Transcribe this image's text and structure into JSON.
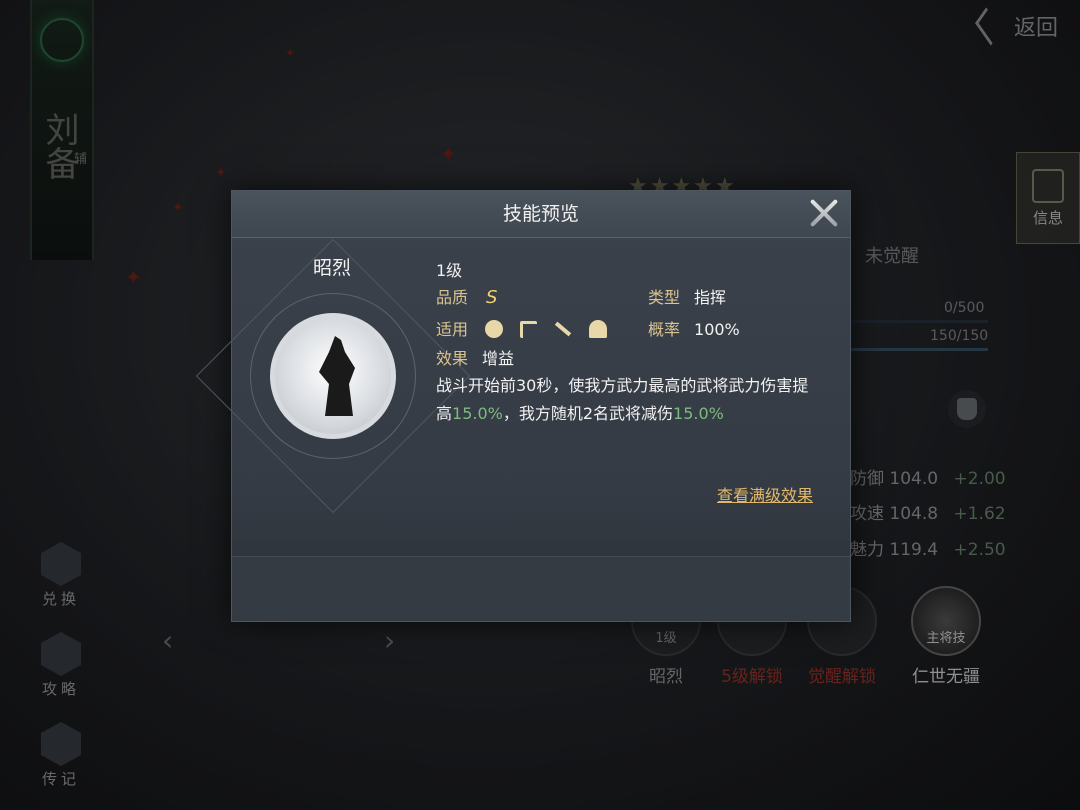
{
  "top": {
    "back_label": "返回"
  },
  "banner": {
    "calligraphy": "刘备",
    "sub": "辅"
  },
  "side_tab": {
    "label": "信息"
  },
  "left_menu": [
    {
      "label": "兑换",
      "icon": "exchange-icon"
    },
    {
      "label": "攻略",
      "icon": "guide-icon"
    },
    {
      "label": "传记",
      "icon": "biography-icon"
    }
  ],
  "right_panel": {
    "stars": "★★★★★",
    "awaken_status": "未觉醒",
    "bar1": "0/500",
    "bar2": "150/150",
    "stats": [
      {
        "name": "防御",
        "value": "104.0",
        "plus": "+2.00"
      },
      {
        "name": "攻速",
        "value": "104.8",
        "plus": "+1.62"
      },
      {
        "name": "魅力",
        "value": "119.4",
        "plus": "+2.50"
      }
    ]
  },
  "skill_slots": [
    {
      "name": "昭烈",
      "badge": "1级",
      "locked": false
    },
    {
      "name": "5级解锁",
      "badge": "",
      "locked": true
    },
    {
      "name": "觉醒解锁",
      "badge": "",
      "locked": true
    },
    {
      "name": "仁世无疆",
      "badge": "主将技",
      "locked": false
    }
  ],
  "dialog": {
    "title": "技能预览",
    "skill_name": "昭烈",
    "level": "1级",
    "quality_label": "品质",
    "quality_value": "S",
    "type_label": "类型",
    "type_value": "指挥",
    "apply_label": "适用",
    "apply_icons": [
      "shield-icon",
      "bow-icon",
      "spear-icon",
      "horse-icon"
    ],
    "rate_label": "概率",
    "rate_value": "100%",
    "effect_label": "效果",
    "effect_value": "增益",
    "desc_part1": "战斗开始前30秒，使我方武力最高的武将武力伤害提高",
    "desc_hl1": "15.0%",
    "desc_part2": "，我方随机2名武将减伤",
    "desc_hl2": "15.0%",
    "full_level_link": "查看满级效果"
  },
  "colors": {
    "label_gold": "#d9c48f",
    "highlight_green": "#7dbb7d",
    "link_orange": "#e2b86a",
    "locked_red": "#a0352a"
  }
}
